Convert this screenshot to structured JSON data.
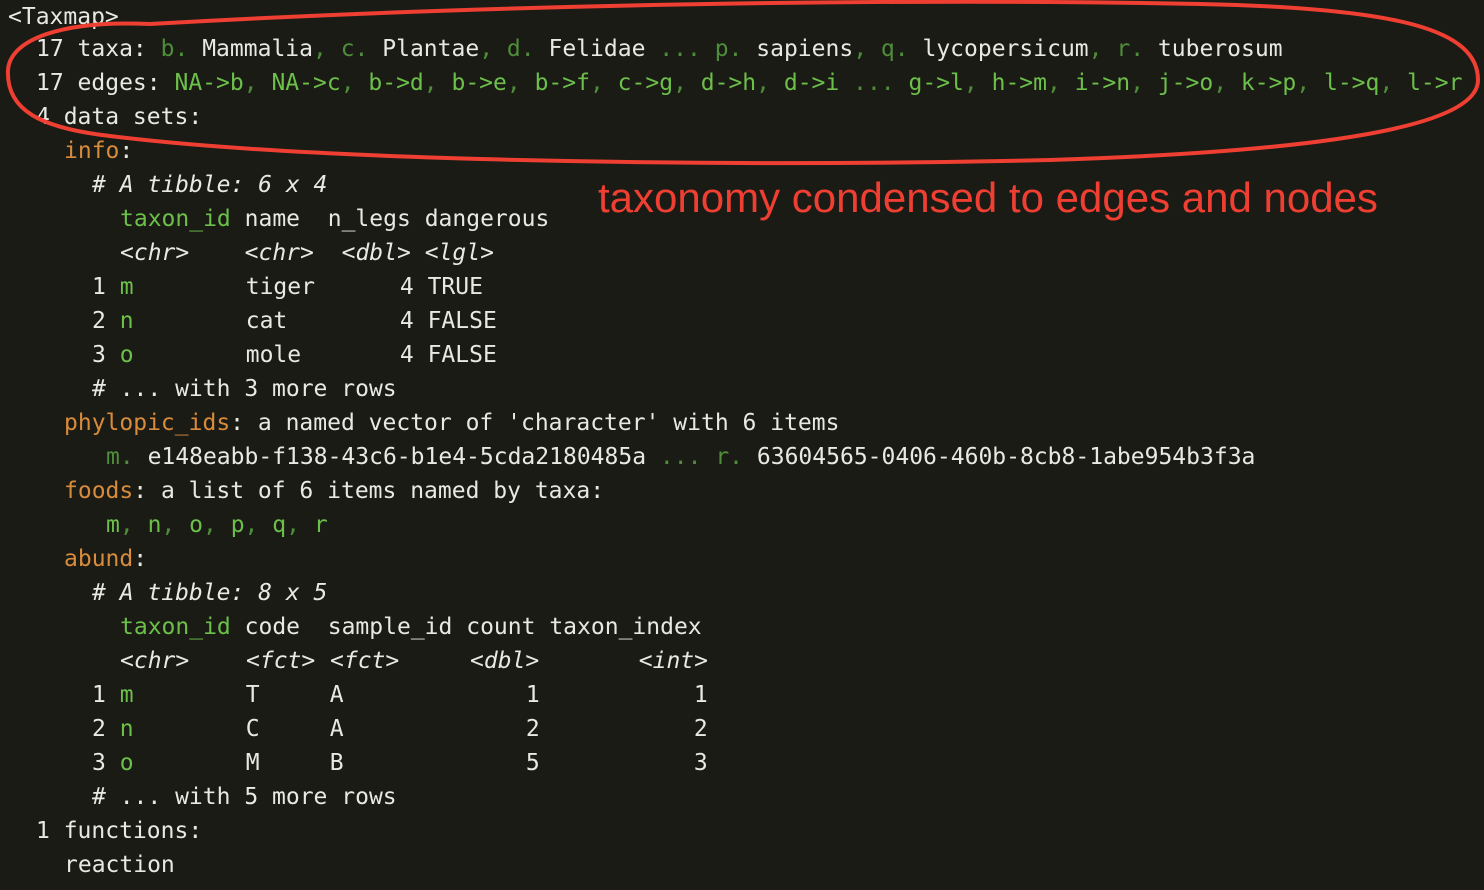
{
  "taxmap": {
    "header": "<Taxmap>",
    "taxa": {
      "label": "17 taxa:",
      "items": [
        {
          "id": "b.",
          "name": "Mammalia"
        },
        {
          "id": "c.",
          "name": "Plantae"
        },
        {
          "id": "d.",
          "name": "Felidae"
        },
        {
          "id": "p.",
          "name": "sapiens"
        },
        {
          "id": "q.",
          "name": "lycopersicum"
        },
        {
          "id": "r.",
          "name": "tuberosum"
        }
      ],
      "ellipsis": "..."
    },
    "edges": {
      "label": "17 edges:",
      "items_a": [
        "NA->b",
        "NA->c",
        "b->d",
        "b->e",
        "b->f",
        "c->g",
        "d->h",
        "d->i"
      ],
      "ellipsis": "...",
      "items_b": [
        "g->l",
        "h->m",
        "i->n",
        "j->o",
        "k->p",
        "l->q",
        "l->r"
      ]
    },
    "datasets_label": "4 data sets:",
    "info": {
      "name": "info",
      "tibble_caption": "# A tibble: 6 x 4",
      "columns": [
        "taxon_id",
        "name",
        "n_legs",
        "dangerous"
      ],
      "types": [
        "<chr>",
        "<chr>",
        "<dbl>",
        "<lgl>"
      ],
      "rows": [
        {
          "n": "1",
          "taxon_id": "m",
          "name": "tiger",
          "n_legs": "4",
          "dangerous": "TRUE"
        },
        {
          "n": "2",
          "taxon_id": "n",
          "name": "cat",
          "n_legs": "4",
          "dangerous": "FALSE"
        },
        {
          "n": "3",
          "taxon_id": "o",
          "name": "mole",
          "n_legs": "4",
          "dangerous": "FALSE"
        }
      ],
      "more_rows": "# ... with 3 more rows"
    },
    "phylopic_ids": {
      "name": "phylopic_ids",
      "desc": "a named vector of 'character' with 6 items",
      "first_id": "m.",
      "first_value": "e148eabb-f138-43c6-b1e4-5cda2180485a",
      "ellipsis": "...",
      "last_id": "r.",
      "last_value": "63604565-0406-460b-8cb8-1abe954b3f3a"
    },
    "foods": {
      "name": "foods",
      "desc": "a list of 6 items named by taxa:",
      "items": [
        "m",
        "n",
        "o",
        "p",
        "q",
        "r"
      ]
    },
    "abund": {
      "name": "abund",
      "tibble_caption": "# A tibble: 8 x 5",
      "columns": [
        "taxon_id",
        "code",
        "sample_id",
        "count",
        "taxon_index"
      ],
      "types": [
        "<chr>",
        "<fct>",
        "<fct>",
        "<dbl>",
        "<int>"
      ],
      "rows": [
        {
          "n": "1",
          "taxon_id": "m",
          "code": "T",
          "sample_id": "A",
          "count": "1",
          "taxon_index": "1"
        },
        {
          "n": "2",
          "taxon_id": "n",
          "code": "C",
          "sample_id": "A",
          "count": "2",
          "taxon_index": "2"
        },
        {
          "n": "3",
          "taxon_id": "o",
          "code": "M",
          "sample_id": "B",
          "count": "5",
          "taxon_index": "3"
        }
      ],
      "more_rows": "# ... with 5 more rows"
    },
    "functions_label": "1 functions:",
    "functions": [
      "reaction"
    ]
  },
  "annotation": {
    "text": "taxonomy condensed to edges and nodes",
    "color": "#ee3f32"
  },
  "colors": {
    "background": "#1b1b15",
    "text": "#e9e9e3",
    "taxon_id": "#6cc04a",
    "dataset_name": "#d98b3c"
  }
}
